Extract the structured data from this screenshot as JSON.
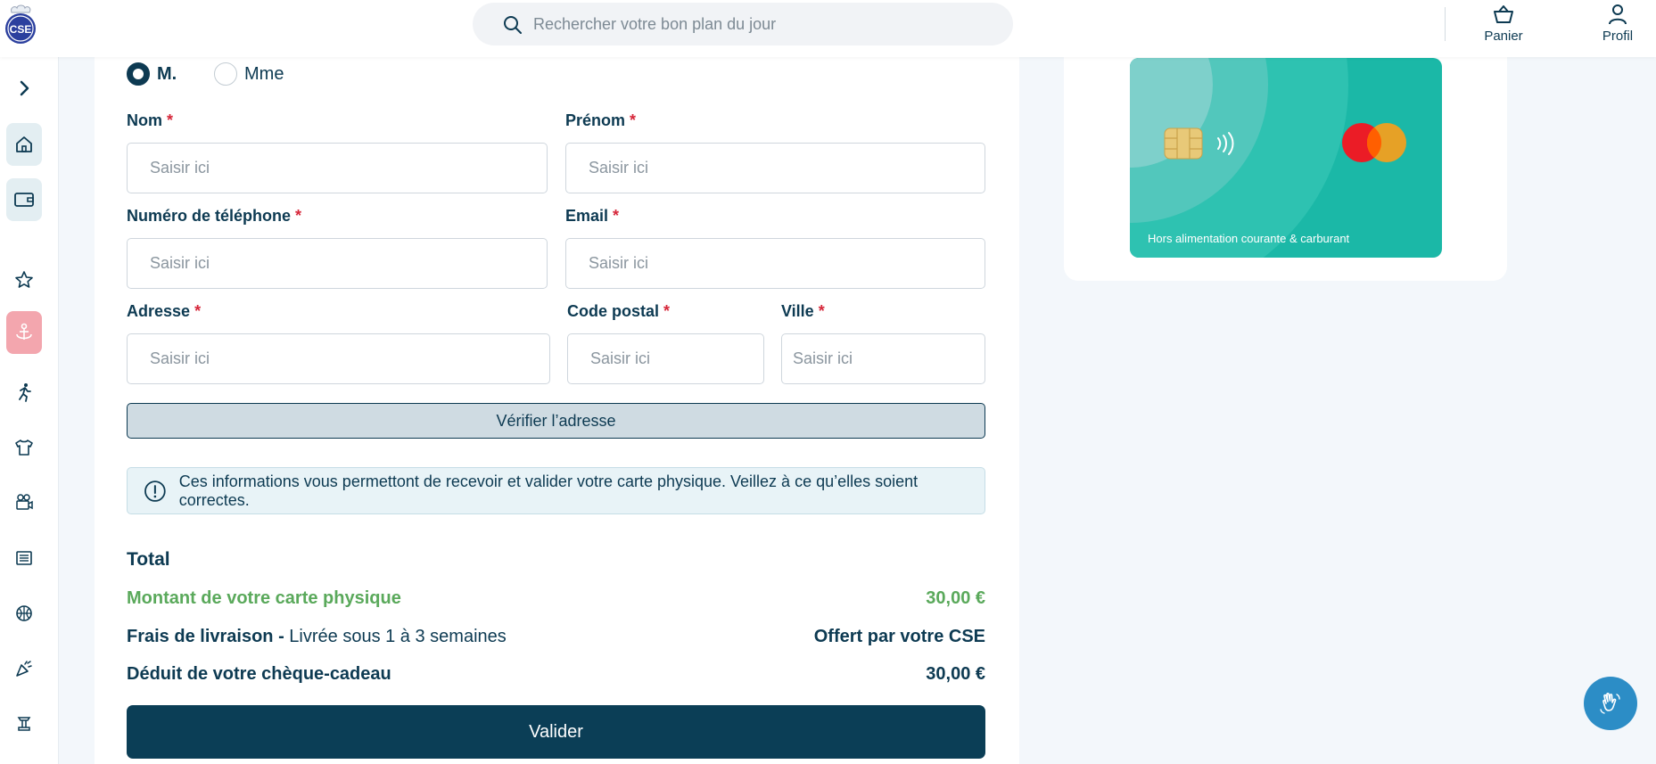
{
  "header": {
    "logo_text": "CSE",
    "search_placeholder": "Rechercher votre bon plan du jour",
    "cart_label": "Panier",
    "profile_label": "Profil"
  },
  "sidebar": {
    "items": [
      {
        "icon": "chevron-right-icon"
      },
      {
        "icon": "home-icon"
      },
      {
        "icon": "wallet-icon"
      },
      {
        "icon": "star-icon"
      },
      {
        "icon": "anchor-icon"
      },
      {
        "icon": "running-icon"
      },
      {
        "icon": "tshirt-icon"
      },
      {
        "icon": "cinema-icon"
      },
      {
        "icon": "newspaper-icon"
      },
      {
        "icon": "basketball-icon"
      },
      {
        "icon": "party-icon"
      },
      {
        "icon": "monument-icon"
      }
    ]
  },
  "form": {
    "civility": [
      {
        "label": "M.",
        "selected": true
      },
      {
        "label": "Mme",
        "selected": false
      }
    ],
    "required_mark": "*",
    "fields": {
      "nom": {
        "label": "Nom",
        "placeholder": "Saisir ici"
      },
      "prenom": {
        "label": "Prénom",
        "placeholder": "Saisir ici"
      },
      "telephone": {
        "label": "Numéro de téléphone",
        "placeholder": "Saisir ici"
      },
      "email": {
        "label": "Email",
        "placeholder": "Saisir ici"
      },
      "adresse": {
        "label": "Adresse",
        "placeholder": "Saisir ici"
      },
      "code_postal": {
        "label": "Code postal",
        "placeholder": "Saisir ici"
      },
      "ville": {
        "label": "Ville",
        "placeholder": "Saisir ici"
      }
    },
    "verify_button": "Vérifier l’adresse",
    "info_text": "Ces informations vous permettont de recevoir et valider votre carte physique. Veillez à ce qu’elles soient correctes."
  },
  "total": {
    "title": "Total",
    "card_amount_label": "Montant de votre carte physique",
    "card_amount_value": "30,00 €",
    "delivery_label": "Frais de livraison -",
    "delivery_detail": "Livrée sous 1 à 3 semaines",
    "delivery_value": "Offert par votre CSE",
    "deduction_label": "Déduit de votre chèque-cadeau",
    "deduction_value": "30,00 €",
    "validate_button": "Valider"
  },
  "card": {
    "note": "Hors alimentation courante & carburant"
  },
  "colors": {
    "primary": "#0b3e56",
    "green": "#5aa95b",
    "required": "#d6273a",
    "card": "#1bb8a7",
    "fab": "#2c8dc6"
  }
}
